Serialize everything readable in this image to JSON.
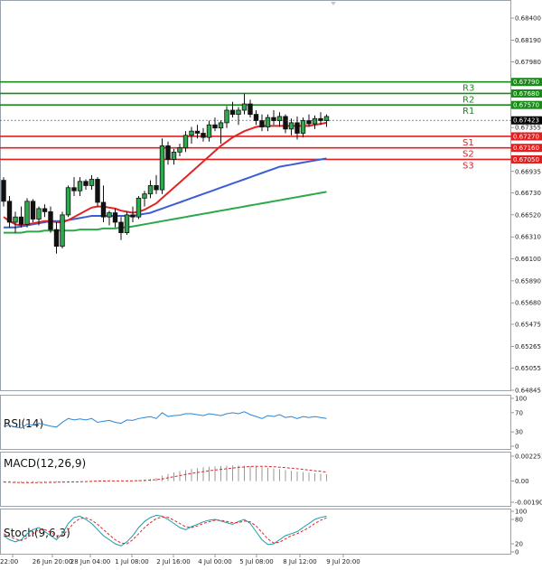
{
  "chart_data": [
    {
      "type": "candlestick",
      "name": "price",
      "y_ticks": [
        "0.68400",
        "0.68190",
        "0.67980",
        "0.67790",
        "0.67680",
        "0.67570",
        "0.67355",
        "0.67145",
        "0.66935",
        "0.66730",
        "0.66520",
        "0.66310",
        "0.66100",
        "0.65890",
        "0.65680",
        "0.65475",
        "0.65265",
        "0.65055",
        "0.64845"
      ],
      "ylim": [
        0.64845,
        0.684
      ],
      "x_ticks": [
        "22:00",
        "26 Jun 20:00",
        "28 Jun 04:00",
        "1 Jul 08:00",
        "2 Jul 16:00",
        "4 Jul 00:00",
        "5 Jul 08:00",
        "8 Jul 12:00",
        "9 Jul 20:00"
      ],
      "current_price": "0.67423",
      "levels": [
        {
          "label": "R3",
          "value": 0.6779,
          "value_text": "0.67790",
          "color": "#1b8a1b"
        },
        {
          "label": "R2",
          "value": 0.6768,
          "value_text": "0.67680",
          "color": "#1b8a1b"
        },
        {
          "label": "R1",
          "value": 0.6757,
          "value_text": "0.67570",
          "color": "#1b8a1b"
        },
        {
          "label": "S1",
          "value": 0.6727,
          "value_text": "0.67270",
          "color": "#e02020"
        },
        {
          "label": "S2",
          "value": 0.6716,
          "value_text": "0.67160",
          "color": "#e02020"
        },
        {
          "label": "S3",
          "value": 0.6705,
          "value_text": "0.67050",
          "color": "#e02020"
        }
      ],
      "candles": [
        [
          0.6685,
          0.6688,
          0.666,
          0.6665
        ],
        [
          0.6665,
          0.667,
          0.664,
          0.6645
        ],
        [
          0.6645,
          0.6655,
          0.6635,
          0.665
        ],
        [
          0.665,
          0.666,
          0.664,
          0.6643
        ],
        [
          0.6643,
          0.6668,
          0.664,
          0.6665
        ],
        [
          0.6665,
          0.6667,
          0.6645,
          0.6648
        ],
        [
          0.6648,
          0.666,
          0.6642,
          0.6658
        ],
        [
          0.6658,
          0.6662,
          0.665,
          0.6655
        ],
        [
          0.6655,
          0.666,
          0.6635,
          0.6638
        ],
        [
          0.6638,
          0.6645,
          0.6615,
          0.6622
        ],
        [
          0.6622,
          0.6655,
          0.662,
          0.6652
        ],
        [
          0.6652,
          0.668,
          0.665,
          0.6678
        ],
        [
          0.6678,
          0.6688,
          0.667,
          0.6675
        ],
        [
          0.6675,
          0.6688,
          0.667,
          0.6684
        ],
        [
          0.6684,
          0.6686,
          0.6676,
          0.668
        ],
        [
          0.668,
          0.669,
          0.6676,
          0.6686
        ],
        [
          0.6686,
          0.6688,
          0.666,
          0.6664
        ],
        [
          0.6664,
          0.668,
          0.6645,
          0.665
        ],
        [
          0.665,
          0.6656,
          0.6642,
          0.6654
        ],
        [
          0.6654,
          0.6658,
          0.664,
          0.6645
        ],
        [
          0.6645,
          0.665,
          0.6628,
          0.6635
        ],
        [
          0.6635,
          0.6655,
          0.6633,
          0.6652
        ],
        [
          0.6652,
          0.666,
          0.6645,
          0.665
        ],
        [
          0.665,
          0.667,
          0.6648,
          0.6668
        ],
        [
          0.6668,
          0.6675,
          0.666,
          0.6672
        ],
        [
          0.6672,
          0.6685,
          0.6668,
          0.668
        ],
        [
          0.668,
          0.669,
          0.6672,
          0.6676
        ],
        [
          0.6676,
          0.6725,
          0.6672,
          0.6718
        ],
        [
          0.6718,
          0.6722,
          0.67,
          0.6705
        ],
        [
          0.6705,
          0.6715,
          0.67,
          0.6712
        ],
        [
          0.6712,
          0.672,
          0.6708,
          0.6716
        ],
        [
          0.6716,
          0.6732,
          0.6712,
          0.6728
        ],
        [
          0.6728,
          0.6736,
          0.672,
          0.6732
        ],
        [
          0.6732,
          0.6738,
          0.6725,
          0.673
        ],
        [
          0.673,
          0.6735,
          0.6722,
          0.6726
        ],
        [
          0.6726,
          0.6742,
          0.6722,
          0.6738
        ],
        [
          0.6738,
          0.6745,
          0.6732,
          0.6735
        ],
        [
          0.6735,
          0.6742,
          0.672,
          0.674
        ],
        [
          0.674,
          0.6756,
          0.6735,
          0.6752
        ],
        [
          0.6752,
          0.676,
          0.6745,
          0.6748
        ],
        [
          0.6748,
          0.6755,
          0.6738,
          0.6752
        ],
        [
          0.6752,
          0.6768,
          0.6748,
          0.6758
        ],
        [
          0.6758,
          0.6762,
          0.6745,
          0.6748
        ],
        [
          0.6748,
          0.6752,
          0.6738,
          0.6742
        ],
        [
          0.6742,
          0.6748,
          0.6732,
          0.6736
        ],
        [
          0.6736,
          0.6748,
          0.6732,
          0.6745
        ],
        [
          0.6745,
          0.6752,
          0.6738,
          0.6742
        ],
        [
          0.6742,
          0.675,
          0.6736,
          0.6746
        ],
        [
          0.6746,
          0.6748,
          0.673,
          0.6734
        ],
        [
          0.6734,
          0.6744,
          0.6728,
          0.674
        ],
        [
          0.674,
          0.6746,
          0.6724,
          0.673
        ],
        [
          0.673,
          0.6745,
          0.6726,
          0.6742
        ],
        [
          0.6742,
          0.6748,
          0.6736,
          0.6739
        ],
        [
          0.6739,
          0.6747,
          0.6734,
          0.6744
        ],
        [
          0.6744,
          0.675,
          0.6738,
          0.6742
        ],
        [
          0.6742,
          0.6748,
          0.6736,
          0.6746
        ]
      ],
      "ma_red": [
        0.665,
        0.6646,
        0.6643,
        0.6642,
        0.6643,
        0.6644,
        0.6645,
        0.6646,
        0.6646,
        0.6645,
        0.6645,
        0.6647,
        0.665,
        0.6653,
        0.6656,
        0.6659,
        0.666,
        0.666,
        0.6659,
        0.6658,
        0.6656,
        0.6655,
        0.6654,
        0.6655,
        0.6657,
        0.666,
        0.6663,
        0.6668,
        0.6673,
        0.6678,
        0.6683,
        0.6688,
        0.6693,
        0.6698,
        0.6703,
        0.6708,
        0.6713,
        0.6718,
        0.6722,
        0.6726,
        0.6729,
        0.6732,
        0.6734,
        0.6736,
        0.6737,
        0.6737,
        0.6737,
        0.6737,
        0.6737,
        0.6737,
        0.6737,
        0.6737,
        0.6737,
        0.6738,
        0.6739,
        0.674
      ],
      "ma_blue": [
        0.664,
        0.664,
        0.664,
        0.6641,
        0.6642,
        0.6643,
        0.6644,
        0.6645,
        0.6646,
        0.6646,
        0.6646,
        0.6647,
        0.6648,
        0.6649,
        0.665,
        0.6651,
        0.6651,
        0.6651,
        0.6651,
        0.6651,
        0.6651,
        0.6651,
        0.6651,
        0.6652,
        0.6653,
        0.6654,
        0.6656,
        0.6658,
        0.666,
        0.6662,
        0.6664,
        0.6666,
        0.6668,
        0.667,
        0.6672,
        0.6674,
        0.6676,
        0.6678,
        0.668,
        0.6682,
        0.6684,
        0.6686,
        0.6688,
        0.669,
        0.6692,
        0.6694,
        0.6696,
        0.6698,
        0.6699,
        0.67,
        0.6701,
        0.6702,
        0.6703,
        0.6704,
        0.6705,
        0.6706
      ],
      "ma_green": [
        0.6635,
        0.6635,
        0.6635,
        0.6635,
        0.6636,
        0.6636,
        0.6636,
        0.6637,
        0.6637,
        0.6637,
        0.6637,
        0.6637,
        0.6637,
        0.6638,
        0.6638,
        0.6638,
        0.6638,
        0.6639,
        0.6639,
        0.6639,
        0.664,
        0.664,
        0.6641,
        0.6642,
        0.6643,
        0.6644,
        0.6645,
        0.6646,
        0.6647,
        0.6648,
        0.6649,
        0.665,
        0.6651,
        0.6652,
        0.6653,
        0.6654,
        0.6655,
        0.6656,
        0.6657,
        0.6658,
        0.6659,
        0.666,
        0.6661,
        0.6662,
        0.6663,
        0.6664,
        0.6665,
        0.6666,
        0.6667,
        0.6668,
        0.6669,
        0.667,
        0.6671,
        0.6672,
        0.6673,
        0.6674
      ]
    },
    {
      "type": "line",
      "name": "RSI(14)",
      "y_ticks": [
        "100",
        "70",
        "30",
        "0"
      ],
      "ylim": [
        0,
        100
      ],
      "values": [
        42,
        44,
        40,
        38,
        46,
        44,
        48,
        45,
        42,
        40,
        50,
        58,
        55,
        57,
        55,
        58,
        50,
        52,
        54,
        50,
        48,
        55,
        54,
        58,
        60,
        62,
        58,
        70,
        62,
        64,
        65,
        68,
        68,
        66,
        64,
        68,
        66,
        64,
        68,
        70,
        68,
        72,
        66,
        62,
        58,
        64,
        62,
        66,
        60,
        62,
        58,
        62,
        60,
        62,
        60,
        58
      ]
    },
    {
      "type": "bar",
      "name": "MACD(12,26,9)",
      "y_ticks": [
        "0.002253",
        "0.00",
        "-0.001907"
      ],
      "ylim": [
        -0.001907,
        0.002253
      ],
      "values": [
        -0.0001,
        -0.00012,
        -0.00014,
        -0.00015,
        -0.00014,
        -0.00013,
        -0.00012,
        -0.00011,
        -0.0001,
        -9e-05,
        -8e-05,
        -6e-05,
        -4e-05,
        -2e-05,
        0.0,
        2e-05,
        3e-05,
        3e-05,
        2e-05,
        1e-05,
        0.0,
        2e-05,
        4e-05,
        8e-05,
        0.00014,
        0.0002,
        0.00028,
        0.0005,
        0.00065,
        0.00078,
        0.0009,
        0.001,
        0.0011,
        0.00118,
        0.00125,
        0.0013,
        0.00134,
        0.00138,
        0.0014,
        0.00142,
        0.00142,
        0.0014,
        0.00136,
        0.00132,
        0.00126,
        0.0012,
        0.00114,
        0.00108,
        0.001,
        0.00094,
        0.00088,
        0.00082,
        0.00076,
        0.0007,
        0.00066,
        0.00062
      ],
      "signal": [
        -8e-05,
        -0.0001,
        -0.00012,
        -0.00013,
        -0.00013,
        -0.00013,
        -0.00013,
        -0.00012,
        -0.00011,
        -0.0001,
        -9e-05,
        -8e-05,
        -7e-05,
        -6e-05,
        -4e-05,
        -2e-05,
        0.0,
        1e-05,
        2e-05,
        2e-05,
        2e-05,
        2e-05,
        3e-05,
        4e-05,
        6e-05,
        9e-05,
        0.00013,
        0.0002,
        0.0003,
        0.0004,
        0.0005,
        0.0006,
        0.0007,
        0.00078,
        0.00086,
        0.00094,
        0.001,
        0.00106,
        0.00112,
        0.00118,
        0.00124,
        0.00128,
        0.00132,
        0.00134,
        0.00134,
        0.00132,
        0.0013,
        0.00126,
        0.00122,
        0.00118,
        0.00112,
        0.00106,
        0.001,
        0.00094,
        0.00088,
        0.00082
      ]
    },
    {
      "type": "line",
      "name": "Stoch(9,6,3)",
      "y_ticks": [
        "100",
        "80",
        "20",
        "0"
      ],
      "ylim": [
        0,
        100
      ],
      "k": [
        40,
        30,
        25,
        30,
        45,
        55,
        60,
        50,
        40,
        30,
        45,
        70,
        85,
        88,
        80,
        70,
        55,
        40,
        30,
        20,
        15,
        25,
        40,
        60,
        75,
        85,
        90,
        88,
        80,
        70,
        60,
        55,
        62,
        68,
        74,
        78,
        80,
        76,
        72,
        68,
        75,
        80,
        70,
        50,
        30,
        18,
        20,
        30,
        40,
        45,
        50,
        60,
        70,
        80,
        85,
        88
      ],
      "d": [
        45,
        38,
        32,
        28,
        35,
        45,
        55,
        55,
        48,
        40,
        40,
        55,
        72,
        82,
        84,
        78,
        68,
        55,
        42,
        30,
        22,
        20,
        30,
        45,
        60,
        72,
        82,
        86,
        85,
        78,
        70,
        62,
        60,
        64,
        70,
        74,
        78,
        78,
        75,
        72,
        72,
        76,
        74,
        64,
        48,
        32,
        22,
        24,
        32,
        40,
        45,
        52,
        60,
        70,
        78,
        84
      ]
    }
  ]
}
